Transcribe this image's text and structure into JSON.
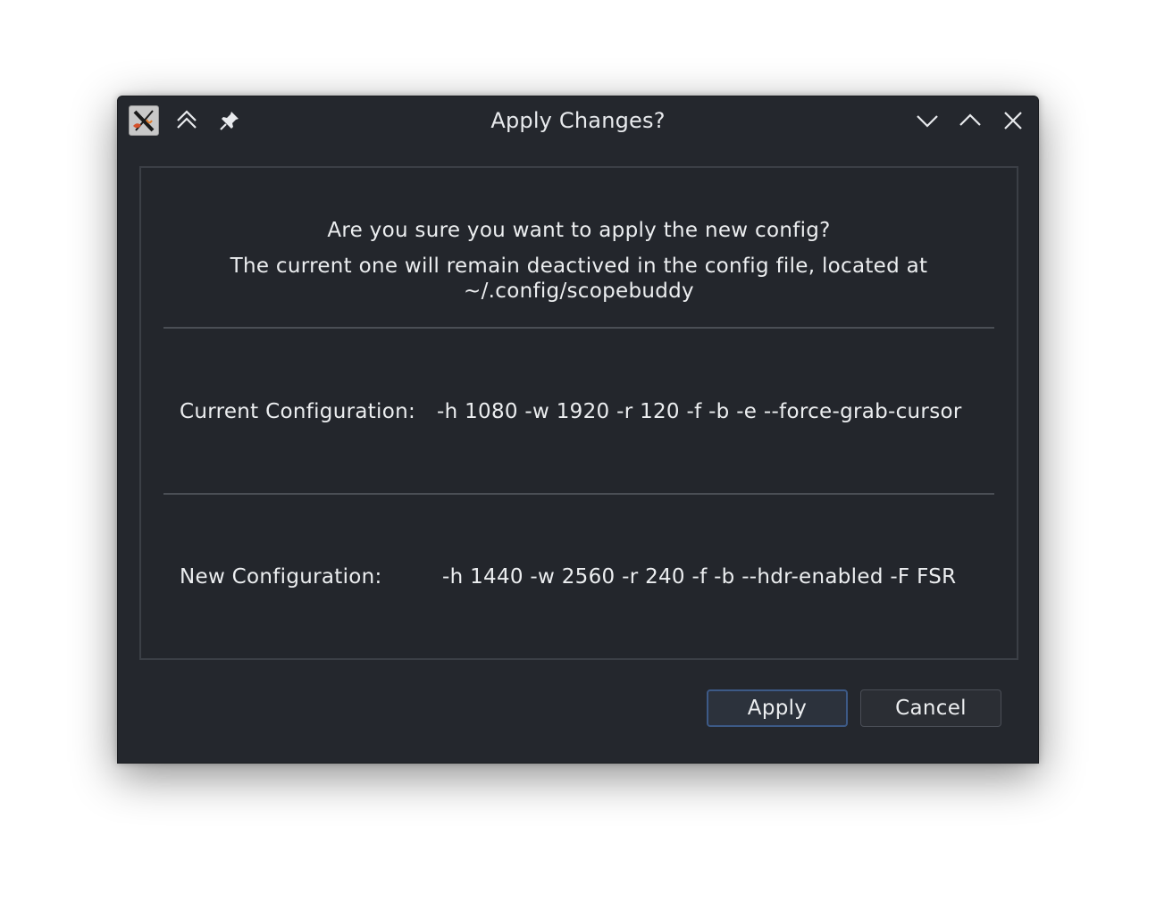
{
  "window": {
    "title": "Apply Changes?"
  },
  "titlebar": {
    "app_icon": "x11-app-icon",
    "keep_above_icon": "double-chevron-up-icon",
    "pin_icon": "pin-icon",
    "minimize_icon": "chevron-down-icon",
    "maximize_icon": "chevron-up-icon",
    "close_icon": "close-icon"
  },
  "message": {
    "line1": "Are you sure you want to apply the new config?",
    "line2": "The current one will remain deactived in the config file, located at",
    "line3": "~/.config/scopebuddy"
  },
  "current": {
    "label": "Current Configuration:",
    "value": "-h 1080 -w 1920 -r 120 -f -b -e --force-grab-cursor"
  },
  "new": {
    "label": "New Configuration:",
    "value": "-h 1440 -w 2560 -r 240 -f -b --hdr-enabled -F FSR"
  },
  "buttons": {
    "apply_label": "Apply",
    "cancel_label": "Cancel"
  },
  "colors": {
    "window_bg": "#24272d",
    "text": "#eceef0",
    "focus_border": "#3d5a86"
  }
}
